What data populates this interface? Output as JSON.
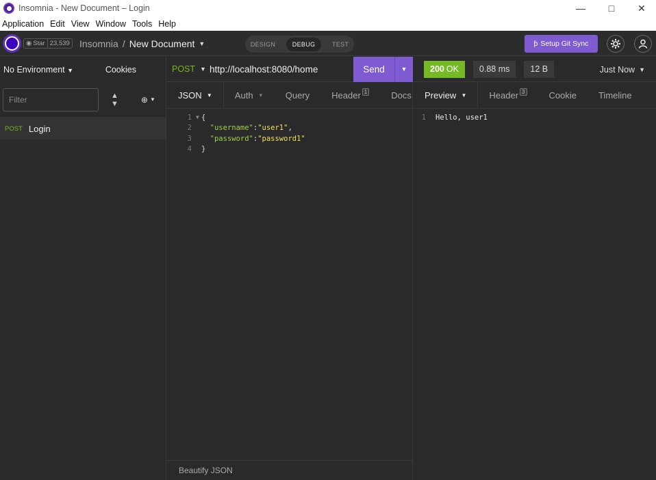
{
  "window": {
    "title": "Insomnia - New Document – Login"
  },
  "menu": [
    "Application",
    "Edit",
    "View",
    "Window",
    "Tools",
    "Help"
  ],
  "header": {
    "star_label": "Star",
    "star_count": "23,539",
    "breadcrumb_root": "Insomnia",
    "breadcrumb_sep": "/",
    "breadcrumb_current": "New Document",
    "modes": [
      "DESIGN",
      "DEBUG",
      "TEST"
    ],
    "active_mode": "DEBUG",
    "git_sync_label": "Setup Git Sync"
  },
  "sidebar": {
    "environment": "No Environment",
    "cookies": "Cookies",
    "filter_placeholder": "Filter",
    "requests": [
      {
        "method": "POST",
        "name": "Login"
      }
    ]
  },
  "request": {
    "method": "POST",
    "url": "http://localhost:8080/home",
    "send_label": "Send",
    "tabs": [
      {
        "label": "JSON",
        "badge": ""
      },
      {
        "label": "Auth",
        "badge": ""
      },
      {
        "label": "Query",
        "badge": ""
      },
      {
        "label": "Header",
        "badge": "1"
      },
      {
        "label": "Docs",
        "badge": ""
      }
    ],
    "body_lines": [
      {
        "num": "1",
        "text": "{"
      },
      {
        "num": "2",
        "key": "\"username\"",
        "value": "\"user1\"",
        "trail": ","
      },
      {
        "num": "3",
        "key": "\"password\"",
        "value": "\"password1\"",
        "trail": ""
      },
      {
        "num": "4",
        "text": "}"
      }
    ],
    "footer": "Beautify JSON"
  },
  "response": {
    "status_code": "200",
    "status_text": "OK",
    "time": "0.88 ms",
    "size": "12 B",
    "timestamp": "Just Now",
    "tabs": [
      {
        "label": "Preview",
        "badge": ""
      },
      {
        "label": "Header",
        "badge": "3"
      },
      {
        "label": "Cookie",
        "badge": ""
      },
      {
        "label": "Timeline",
        "badge": ""
      }
    ],
    "body_lines": [
      {
        "num": "1",
        "text": "Hello, user1"
      }
    ]
  },
  "colors": {
    "accent": "#7e5bd0",
    "success": "#75ba24",
    "method_post": "#75ba24"
  }
}
